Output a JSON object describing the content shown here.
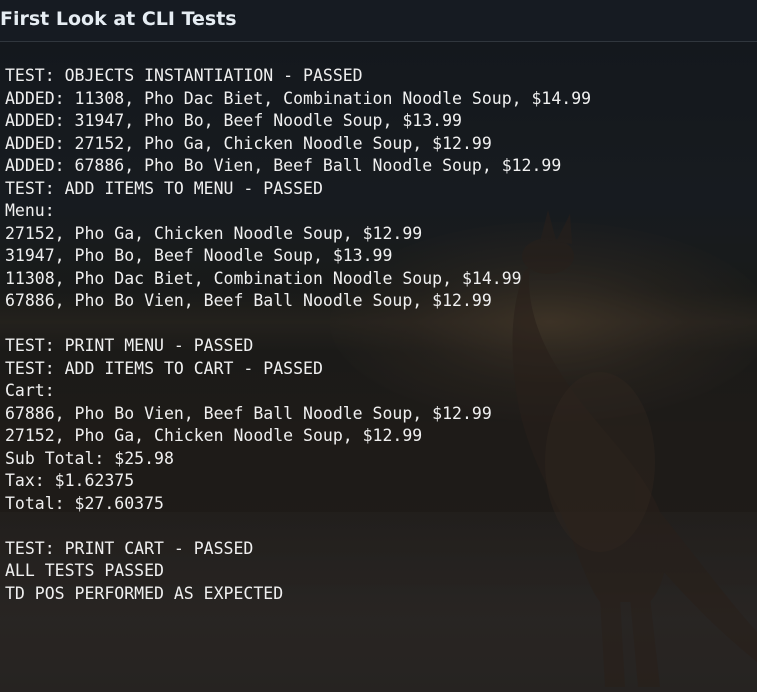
{
  "header": {
    "title": "First Look at CLI Tests"
  },
  "terminal": {
    "lines": [
      "TEST: OBJECTS INSTANTIATION - PASSED",
      "ADDED: 11308, Pho Dac Biet, Combination Noodle Soup, $14.99",
      "ADDED: 31947, Pho Bo, Beef Noodle Soup, $13.99",
      "ADDED: 27152, Pho Ga, Chicken Noodle Soup, $12.99",
      "ADDED: 67886, Pho Bo Vien, Beef Ball Noodle Soup, $12.99",
      "TEST: ADD ITEMS TO MENU - PASSED",
      "Menu:",
      "27152, Pho Ga, Chicken Noodle Soup, $12.99",
      "31947, Pho Bo, Beef Noodle Soup, $13.99",
      "11308, Pho Dac Biet, Combination Noodle Soup, $14.99",
      "67886, Pho Bo Vien, Beef Ball Noodle Soup, $12.99",
      "",
      "TEST: PRINT MENU - PASSED",
      "TEST: ADD ITEMS TO CART - PASSED",
      "Cart:",
      "67886, Pho Bo Vien, Beef Ball Noodle Soup, $12.99",
      "27152, Pho Ga, Chicken Noodle Soup, $12.99",
      "Sub Total: $25.98",
      "Tax: $1.62375",
      "Total: $27.60375",
      "",
      "TEST: PRINT CART - PASSED",
      "ALL TESTS PASSED",
      "TD POS PERFORMED AS EXPECTED"
    ]
  },
  "colors": {
    "terminal_text": "#f0f0f0",
    "header_text": "#e6edf3",
    "header_background": "#161b22"
  }
}
